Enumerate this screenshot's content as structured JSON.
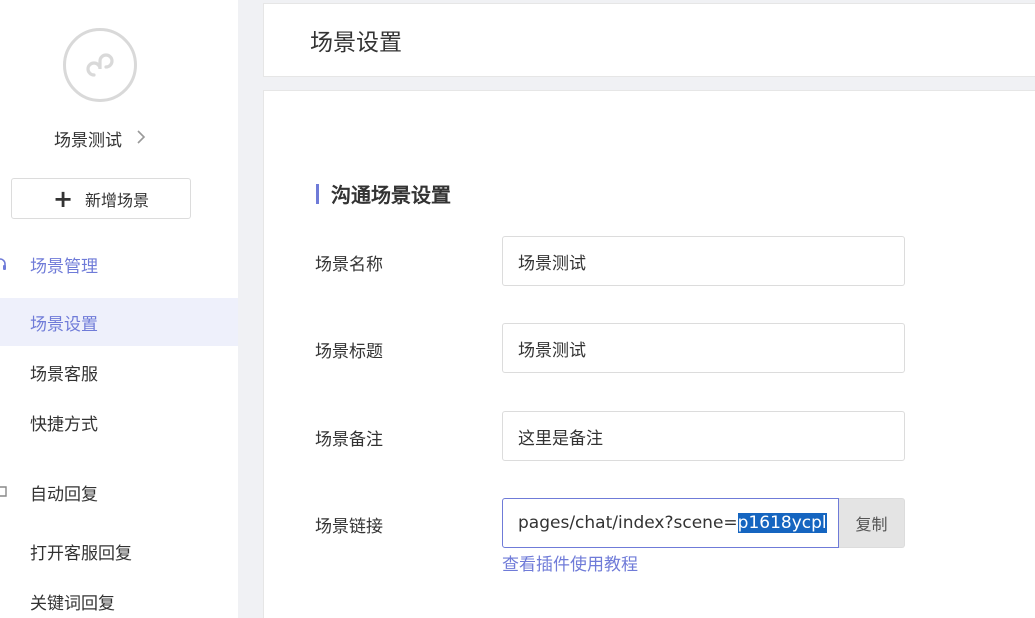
{
  "sidebar": {
    "scene_name": "场景测试",
    "add_scene_label": "新增场景",
    "groups": {
      "scene_management": "场景管理",
      "auto_reply": "自动回复"
    },
    "items": {
      "scene_settings": "场景设置",
      "scene_service": "场景客服",
      "shortcuts": "快捷方式",
      "open_service_reply": "打开客服回复",
      "keyword_reply": "关键词回复"
    }
  },
  "header": {
    "title": "场景设置"
  },
  "form": {
    "section_title": "沟通场景设置",
    "fields": {
      "name": {
        "label": "场景名称",
        "value": "场景测试"
      },
      "title": {
        "label": "场景标题",
        "value": "场景测试"
      },
      "remark": {
        "label": "场景备注",
        "value": "这里是备注"
      },
      "link": {
        "label": "场景链接",
        "prefix": "pages/chat/index?scene=",
        "selected": "p1618ycpl"
      }
    },
    "copy_label": "复制",
    "tutorial_link": "查看插件使用教程"
  },
  "colors": {
    "accent": "#6f7bd8",
    "selection": "#1565c0",
    "active_bg": "#eef0fb"
  }
}
